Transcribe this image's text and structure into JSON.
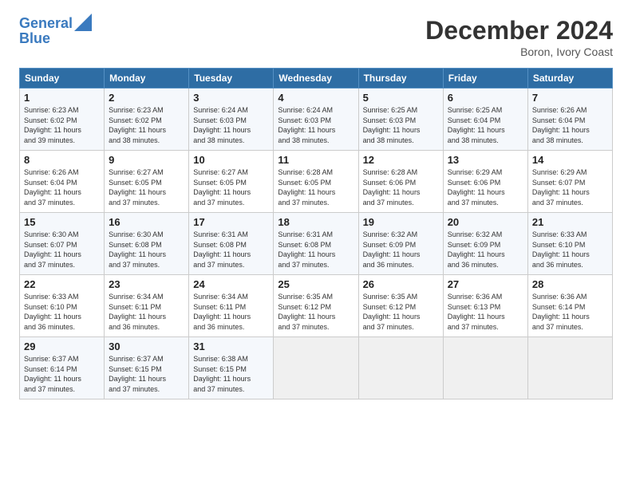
{
  "logo": {
    "line1": "General",
    "line2": "Blue"
  },
  "title": "December 2024",
  "subtitle": "Boron, Ivory Coast",
  "days_header": [
    "Sunday",
    "Monday",
    "Tuesday",
    "Wednesday",
    "Thursday",
    "Friday",
    "Saturday"
  ],
  "weeks": [
    [
      {
        "day": "1",
        "text": "Sunrise: 6:23 AM\nSunset: 6:02 PM\nDaylight: 11 hours\nand 39 minutes."
      },
      {
        "day": "2",
        "text": "Sunrise: 6:23 AM\nSunset: 6:02 PM\nDaylight: 11 hours\nand 38 minutes."
      },
      {
        "day": "3",
        "text": "Sunrise: 6:24 AM\nSunset: 6:03 PM\nDaylight: 11 hours\nand 38 minutes."
      },
      {
        "day": "4",
        "text": "Sunrise: 6:24 AM\nSunset: 6:03 PM\nDaylight: 11 hours\nand 38 minutes."
      },
      {
        "day": "5",
        "text": "Sunrise: 6:25 AM\nSunset: 6:03 PM\nDaylight: 11 hours\nand 38 minutes."
      },
      {
        "day": "6",
        "text": "Sunrise: 6:25 AM\nSunset: 6:04 PM\nDaylight: 11 hours\nand 38 minutes."
      },
      {
        "day": "7",
        "text": "Sunrise: 6:26 AM\nSunset: 6:04 PM\nDaylight: 11 hours\nand 38 minutes."
      }
    ],
    [
      {
        "day": "8",
        "text": "Sunrise: 6:26 AM\nSunset: 6:04 PM\nDaylight: 11 hours\nand 37 minutes."
      },
      {
        "day": "9",
        "text": "Sunrise: 6:27 AM\nSunset: 6:05 PM\nDaylight: 11 hours\nand 37 minutes."
      },
      {
        "day": "10",
        "text": "Sunrise: 6:27 AM\nSunset: 6:05 PM\nDaylight: 11 hours\nand 37 minutes."
      },
      {
        "day": "11",
        "text": "Sunrise: 6:28 AM\nSunset: 6:05 PM\nDaylight: 11 hours\nand 37 minutes."
      },
      {
        "day": "12",
        "text": "Sunrise: 6:28 AM\nSunset: 6:06 PM\nDaylight: 11 hours\nand 37 minutes."
      },
      {
        "day": "13",
        "text": "Sunrise: 6:29 AM\nSunset: 6:06 PM\nDaylight: 11 hours\nand 37 minutes."
      },
      {
        "day": "14",
        "text": "Sunrise: 6:29 AM\nSunset: 6:07 PM\nDaylight: 11 hours\nand 37 minutes."
      }
    ],
    [
      {
        "day": "15",
        "text": "Sunrise: 6:30 AM\nSunset: 6:07 PM\nDaylight: 11 hours\nand 37 minutes."
      },
      {
        "day": "16",
        "text": "Sunrise: 6:30 AM\nSunset: 6:08 PM\nDaylight: 11 hours\nand 37 minutes."
      },
      {
        "day": "17",
        "text": "Sunrise: 6:31 AM\nSunset: 6:08 PM\nDaylight: 11 hours\nand 37 minutes."
      },
      {
        "day": "18",
        "text": "Sunrise: 6:31 AM\nSunset: 6:08 PM\nDaylight: 11 hours\nand 37 minutes."
      },
      {
        "day": "19",
        "text": "Sunrise: 6:32 AM\nSunset: 6:09 PM\nDaylight: 11 hours\nand 36 minutes."
      },
      {
        "day": "20",
        "text": "Sunrise: 6:32 AM\nSunset: 6:09 PM\nDaylight: 11 hours\nand 36 minutes."
      },
      {
        "day": "21",
        "text": "Sunrise: 6:33 AM\nSunset: 6:10 PM\nDaylight: 11 hours\nand 36 minutes."
      }
    ],
    [
      {
        "day": "22",
        "text": "Sunrise: 6:33 AM\nSunset: 6:10 PM\nDaylight: 11 hours\nand 36 minutes."
      },
      {
        "day": "23",
        "text": "Sunrise: 6:34 AM\nSunset: 6:11 PM\nDaylight: 11 hours\nand 36 minutes."
      },
      {
        "day": "24",
        "text": "Sunrise: 6:34 AM\nSunset: 6:11 PM\nDaylight: 11 hours\nand 36 minutes."
      },
      {
        "day": "25",
        "text": "Sunrise: 6:35 AM\nSunset: 6:12 PM\nDaylight: 11 hours\nand 37 minutes."
      },
      {
        "day": "26",
        "text": "Sunrise: 6:35 AM\nSunset: 6:12 PM\nDaylight: 11 hours\nand 37 minutes."
      },
      {
        "day": "27",
        "text": "Sunrise: 6:36 AM\nSunset: 6:13 PM\nDaylight: 11 hours\nand 37 minutes."
      },
      {
        "day": "28",
        "text": "Sunrise: 6:36 AM\nSunset: 6:14 PM\nDaylight: 11 hours\nand 37 minutes."
      }
    ],
    [
      {
        "day": "29",
        "text": "Sunrise: 6:37 AM\nSunset: 6:14 PM\nDaylight: 11 hours\nand 37 minutes."
      },
      {
        "day": "30",
        "text": "Sunrise: 6:37 AM\nSunset: 6:15 PM\nDaylight: 11 hours\nand 37 minutes."
      },
      {
        "day": "31",
        "text": "Sunrise: 6:38 AM\nSunset: 6:15 PM\nDaylight: 11 hours\nand 37 minutes."
      },
      {
        "day": "",
        "text": ""
      },
      {
        "day": "",
        "text": ""
      },
      {
        "day": "",
        "text": ""
      },
      {
        "day": "",
        "text": ""
      }
    ]
  ]
}
